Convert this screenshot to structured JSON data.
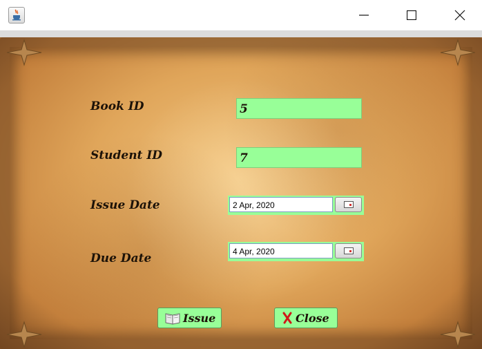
{
  "window": {
    "app_icon": "java-cup-icon",
    "controls": [
      "minimize-icon",
      "maximize-icon",
      "close-icon"
    ]
  },
  "form": {
    "book_id_label": "Book ID",
    "book_id_value": "5",
    "student_id_label": "Student ID",
    "student_id_value": "7",
    "issue_date_label": "Issue Date",
    "issue_date_value": "2 Apr, 2020",
    "due_date_label": "Due Date",
    "due_date_value": "4 Apr, 2020"
  },
  "buttons": {
    "issue_label": "Issue",
    "issue_icon": "book-icon",
    "close_label": "Close",
    "close_icon": "red-x-icon"
  },
  "colors": {
    "field_bg": "#98ff98",
    "label_text": "#1c1208",
    "parchment": "#e2a85c"
  }
}
